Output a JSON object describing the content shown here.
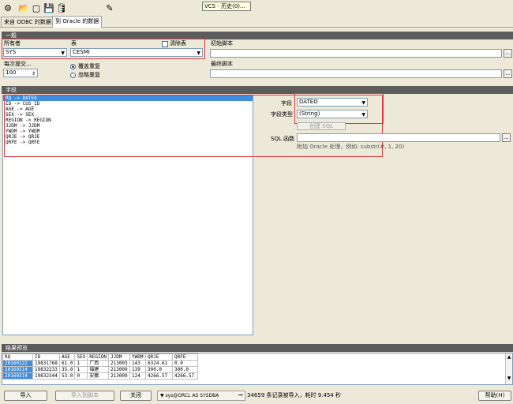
{
  "toolbar": {
    "icons": [
      "settings-icon",
      "open-icon",
      "new-icon",
      "save-icon",
      "database-icon",
      "wand-icon"
    ],
    "tooltip": "VCS - 历史(0)..."
  },
  "tabs": [
    {
      "label": "来自 ODBC 的数据",
      "active": false
    },
    {
      "label": "到 Oracle 的数据",
      "active": true
    }
  ],
  "general": {
    "section_title": "一般",
    "owner_label": "所有者",
    "owner_value": "SYS",
    "table_label": "表",
    "table_value": "CESMI",
    "clear_table_label": "清除表",
    "clear_table_checked": false,
    "init_script_label": "初始脚本",
    "init_script_value": "",
    "commit_label": "每次提交...",
    "commit_value": "100",
    "overwrite_label": "覆盖重复",
    "ignore_label": "忽略重复",
    "final_script_label": "最终脚本",
    "final_script_value": "",
    "dots_button": "..."
  },
  "fields": {
    "section_title": "字段",
    "mappings": [
      "RQ  ->  DATEO",
      "ID  ->  CUS_ID",
      "AGE  ->  AGE",
      "SEX  ->  SEX",
      "REGION  ->  REGION",
      "JJDM  ->  JJDM",
      "YWDM  ->  YWDM",
      "QRJE  ->  QRJE",
      "QRFE  ->  QRFE"
    ],
    "field_label": "字段",
    "field_value": "DATEO",
    "type_label": "字段类型",
    "type_value": "(String)",
    "create_sql_button": "创建 SQL",
    "sql_func_label": "SQL 函数",
    "sql_func_value": "",
    "hint": "附加 Oracle 处理，例如: substr(#, 1, 20)"
  },
  "preview": {
    "section_title": "结果预览",
    "columns": [
      "RQ",
      "ID",
      "AGE",
      "SEX",
      "REGION",
      "JJDM",
      "YWDM",
      "QRJE",
      "QRFE"
    ],
    "rows": [
      [
        "20160122",
        "19831768",
        "61.0",
        "1",
        "广西",
        "213003",
        "143",
        "6324.61",
        "0.0"
      ],
      [
        "20160314",
        "19832233",
        "35.0",
        "1",
        "福建",
        "213009",
        "139",
        "300.0",
        "300.0"
      ],
      [
        "20160314",
        "19832344",
        "53.0",
        "0",
        "安徽",
        "213009",
        "124",
        "4266.57",
        "4266.57"
      ]
    ]
  },
  "bottom": {
    "import_button": "导入",
    "import_script_button": "导入到脚本",
    "close_button": "关闭",
    "connection": "sys@ORCL AS SYSDBA",
    "status": "34659 条记录被导入，耗时 9.454 秒",
    "help_button": "帮助(H)"
  }
}
